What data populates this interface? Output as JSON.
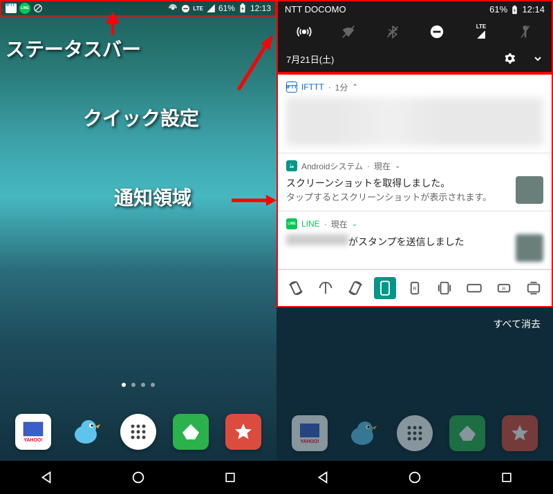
{
  "leftStatus": {
    "ifttt": "IFTT",
    "line": "LINE",
    "lte": "LTE",
    "battery": "61%",
    "time": "12:13"
  },
  "annotations": {
    "statusBar": "ステータスバー",
    "quickSettings": "クイック設定",
    "notificationArea": "通知領域"
  },
  "qs": {
    "carrier": "NTT DOCOMO",
    "battery": "61%",
    "time": "12:14",
    "lte": "LTE",
    "date": "7月21日(土)"
  },
  "notifications": [
    {
      "app": "IFTTT",
      "appColor": "#0066cc",
      "appBg": "#ffffff",
      "meta": "1分",
      "chevron": "⌃",
      "blurred": true
    },
    {
      "app": "Androidシステム",
      "appColor": "#ffffff",
      "appBg": "#009688",
      "meta": "現在",
      "chevron": "⌄",
      "title": "スクリーンショットを取得しました。",
      "sub": "タップするとスクリーンショットが表示されます。"
    },
    {
      "app": "LINE",
      "appColor": "#ffffff",
      "appBg": "#06c755",
      "meta": "現在",
      "chevron": "⌄",
      "titleSuffix": "がスタンプを送信しました"
    }
  ],
  "clearAll": "すべて消去",
  "dockApps": [
    "Yahoo",
    "Twitter",
    "Apps",
    "Feedly",
    "Wunderlist"
  ]
}
